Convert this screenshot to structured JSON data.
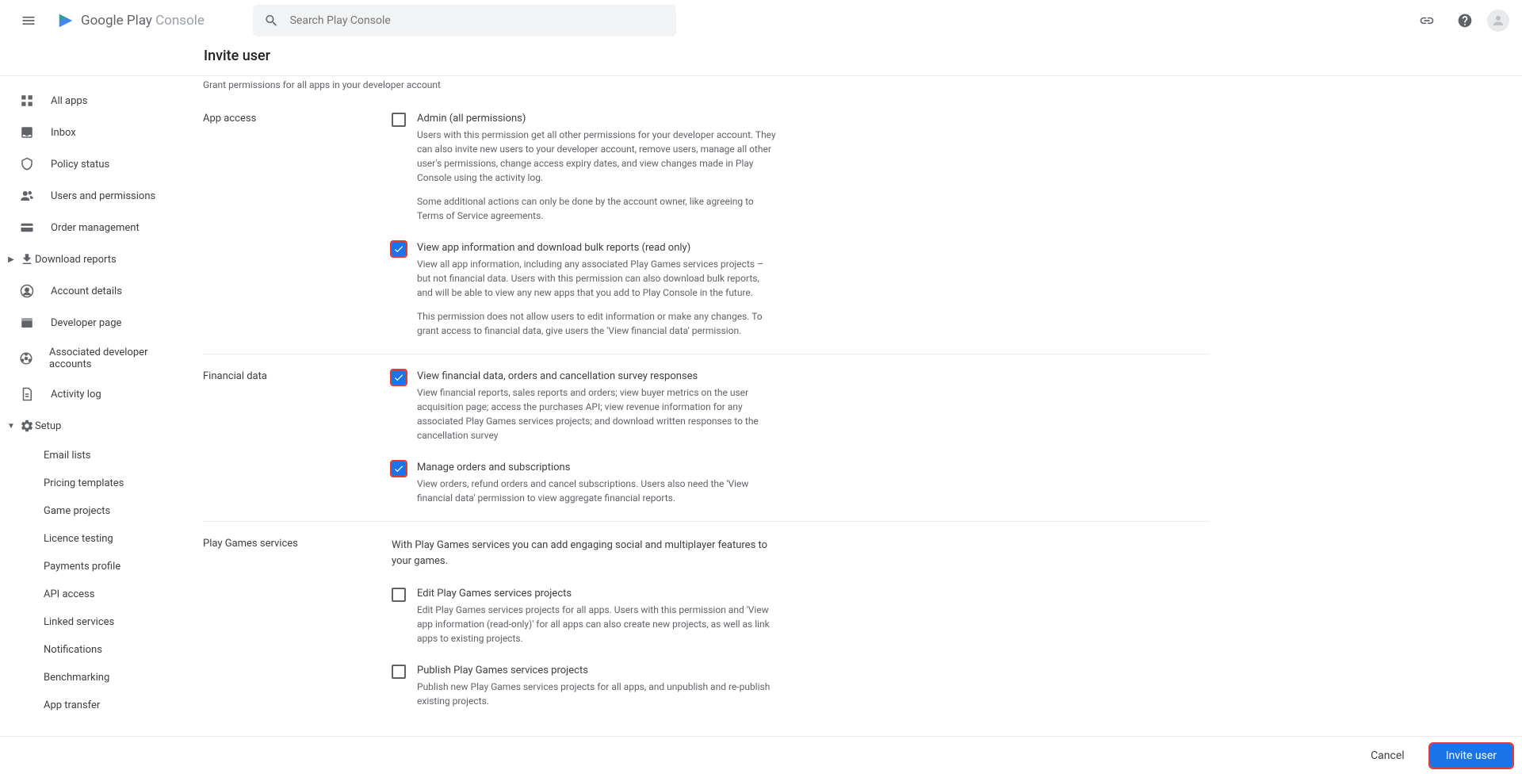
{
  "header": {
    "search_placeholder": "Search Play Console",
    "logo_text_gray": "Google Play",
    "logo_text_light": " Console"
  },
  "subheader": {
    "title": "Invite user"
  },
  "sidebar": {
    "items": [
      {
        "label": "All apps",
        "icon": "apps"
      },
      {
        "label": "Inbox",
        "icon": "inbox"
      },
      {
        "label": "Policy status",
        "icon": "shield"
      },
      {
        "label": "Users and permissions",
        "icon": "people"
      },
      {
        "label": "Order management",
        "icon": "card"
      },
      {
        "label": "Download reports",
        "icon": "download",
        "expand": true
      },
      {
        "label": "Account details",
        "icon": "account"
      },
      {
        "label": "Developer page",
        "icon": "devpage"
      },
      {
        "label": "Associated developer accounts",
        "icon": "assoc"
      },
      {
        "label": "Activity log",
        "icon": "file"
      },
      {
        "label": "Setup",
        "icon": "gear",
        "expand": true,
        "expanded": true
      }
    ],
    "setup_subitems": [
      {
        "label": "Email lists"
      },
      {
        "label": "Pricing templates"
      },
      {
        "label": "Game projects"
      },
      {
        "label": "Licence testing"
      },
      {
        "label": "Payments profile"
      },
      {
        "label": "API access"
      },
      {
        "label": "Linked services"
      },
      {
        "label": "Notifications"
      },
      {
        "label": "Benchmarking"
      },
      {
        "label": "App transfer"
      }
    ]
  },
  "content": {
    "hint": "Grant permissions for all apps in your developer account",
    "sections": [
      {
        "label": "App access",
        "items": [
          {
            "checked": false,
            "title": "Admin (all permissions)",
            "desc": [
              "Users with this permission get all other permissions for your developer account. They can also invite new users to your developer account, remove users, manage all other user's permissions, change access expiry dates, and view changes made in Play Console using the activity log.",
              "Some additional actions can only be done by the account owner, like agreeing to Terms of Service agreements."
            ]
          },
          {
            "checked": true,
            "title": "View app information and download bulk reports (read only)",
            "desc": [
              "View all app information, including any associated Play Games services projects – but not financial data. Users with this permission can also download bulk reports, and will be able to view any new apps that you add to Play Console in the future.",
              "This permission does not allow users to edit information or make any changes. To grant access to financial data, give users the 'View financial data' permission."
            ]
          }
        ]
      },
      {
        "label": "Financial data",
        "items": [
          {
            "checked": true,
            "title": "View financial data, orders and cancellation survey responses",
            "desc": [
              "View financial reports, sales reports and orders; view buyer metrics on the user acquisition page; access the purchases API; view revenue information for any associated Play Games services projects; and download written responses to the cancellation survey"
            ]
          },
          {
            "checked": true,
            "title": "Manage orders and subscriptions",
            "desc": [
              "View orders, refund orders and cancel subscriptions. Users also need the 'View financial data' permission to view aggregate financial reports."
            ]
          }
        ]
      },
      {
        "label": "Play Games services",
        "intro": "With Play Games services you can add engaging social and multiplayer features to your games.",
        "items": [
          {
            "checked": false,
            "title": "Edit Play Games services projects",
            "desc": [
              "Edit Play Games services projects for all apps. Users with this permission and 'View app information (read-only)' for all apps can also create new projects, as well as link apps to existing projects."
            ]
          },
          {
            "checked": false,
            "title": "Publish Play Games services projects",
            "desc": [
              "Publish new Play Games services projects for all apps, and unpublish and re-publish existing projects."
            ]
          }
        ]
      }
    ]
  },
  "footer": {
    "cancel": "Cancel",
    "invite": "Invite user"
  }
}
